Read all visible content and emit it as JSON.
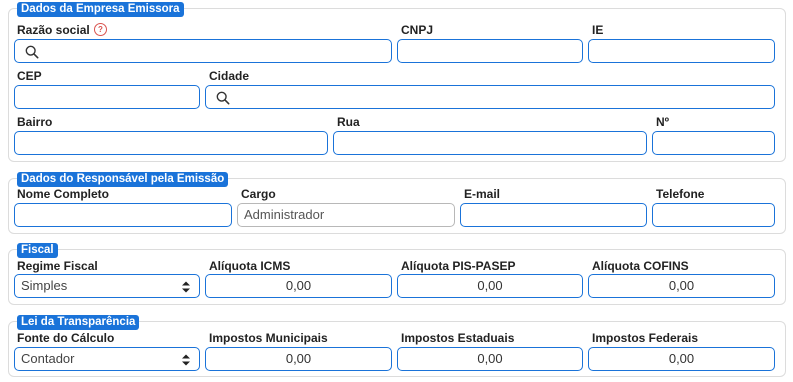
{
  "emissora": {
    "legend": "Dados da Empresa Emissora",
    "razao_social_label": "Razão social",
    "help_icon_glyph": "?",
    "cnpj_label": "CNPJ",
    "ie_label": "IE",
    "cep_label": "CEP",
    "cidade_label": "Cidade",
    "bairro_label": "Bairro",
    "rua_label": "Rua",
    "numero_label": "Nº"
  },
  "responsavel": {
    "legend": "Dados do Responsável pela Emissão",
    "nome_label": "Nome Completo",
    "cargo_label": "Cargo",
    "cargo_value": "Administrador",
    "email_label": "E-mail",
    "telefone_label": "Telefone"
  },
  "fiscal": {
    "legend": "Fiscal",
    "regime_label": "Regime Fiscal",
    "regime_value": "Simples",
    "icms_label": "Alíquota ICMS",
    "icms_value": "0,00",
    "pis_label": "Alíquota PIS-PASEP",
    "pis_value": "0,00",
    "cofins_label": "Alíquota COFINS",
    "cofins_value": "0,00"
  },
  "transparencia": {
    "legend": "Lei da Transparência",
    "fonte_label": "Fonte do Cálculo",
    "fonte_value": "Contador",
    "municipais_label": "Impostos Municipais",
    "municipais_value": "0,00",
    "estaduais_label": "Impostos Estaduais",
    "estaduais_value": "0,00",
    "federais_label": "Impostos Federais",
    "federais_value": "0,00"
  },
  "icons": {
    "search": "search-icon",
    "select_caret": "chevron-up-down-icon",
    "help": "help-icon"
  },
  "colors": {
    "accent": "#1a73d9",
    "help": "#d9534f",
    "border": "#dcdcdc"
  }
}
